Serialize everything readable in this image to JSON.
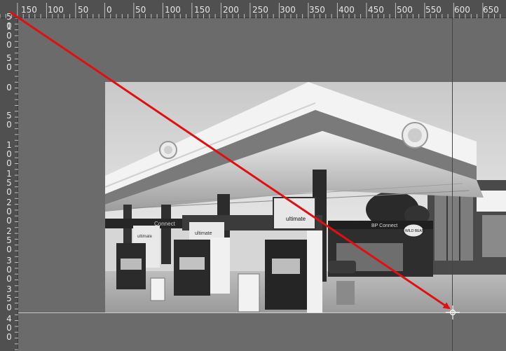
{
  "ruler": {
    "horizontal_labels": [
      "150",
      "100",
      "50",
      "0",
      "50",
      "100",
      "150",
      "200",
      "250",
      "300",
      "350",
      "400",
      "450",
      "500",
      "550",
      "600",
      "650"
    ],
    "vertical_labels": [
      "50",
      "100",
      "50",
      "0",
      "50",
      "100",
      "150",
      "200",
      "250",
      "300",
      "350",
      "400"
    ]
  },
  "photo": {
    "signs": {
      "ultimate_a": "ultimate",
      "ultimate_b": "ultimate",
      "ultimate_c": "ultimate",
      "bp_connect": "BP Connect",
      "wild_bean": "WILD BEAN",
      "fascia": "Connect"
    }
  },
  "colors": {
    "ruler_bg": "#505050",
    "canvas_bg": "#6b6b6b",
    "arrow": "#e01010",
    "guide": "#2d4a66"
  },
  "icons": [
    "crosshair-cursor-icon"
  ]
}
